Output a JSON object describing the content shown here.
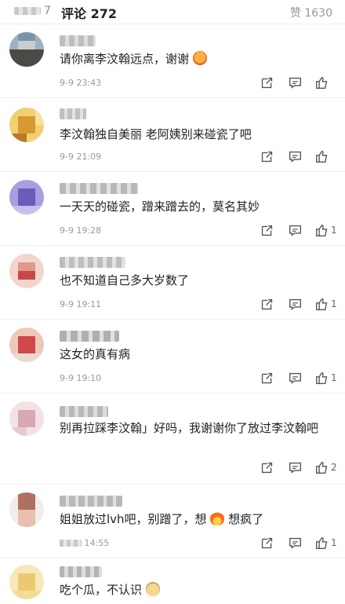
{
  "header": {
    "reposts_suffix": "7",
    "comments_label": "评论 272",
    "likes_label": "赞 1630"
  },
  "comments": [
    {
      "text": "请你离李汶翰远点，谢谢",
      "time": "9-9 23:43",
      "likes": "",
      "emoji": "angry-face-icon",
      "avatar_color": "#6f8aa0"
    },
    {
      "text": "李汶翰独自美丽 老阿姨别来碰瓷了吧",
      "time": "9-9 21:09",
      "likes": "",
      "emoji": "",
      "avatar_color": "#e8c050"
    },
    {
      "text": "一天天的碰瓷，蹭来蹭去的，莫名其妙",
      "time": "9-9 19:28",
      "likes": "1",
      "emoji": "",
      "avatar_color": "#8c7fc8"
    },
    {
      "text": "也不知道自己多大岁数了",
      "time": "9-9 19:11",
      "likes": "1",
      "emoji": "",
      "avatar_color": "#e8b0a8"
    },
    {
      "text": "这女的真有病",
      "time": "9-9 19:10",
      "likes": "1",
      "emoji": "",
      "avatar_color": "#d04848"
    },
    {
      "text": "别再拉踩李汶翰」好吗，我谢谢你了放过李汶翰吧",
      "time": "",
      "likes": "2",
      "emoji": "",
      "avatar_color": "#e4c8d0"
    },
    {
      "text": "姐姐放过lvh吧，别蹭了，想",
      "text2": "想疯了",
      "time": "14:55",
      "likes": "1",
      "emoji": "fire-icon",
      "avatar_color": "#c89078"
    },
    {
      "text": "吃个瓜，不认识",
      "time": "",
      "likes": "",
      "emoji": "doge-icon",
      "avatar_color": "#f0d898"
    }
  ],
  "colors": {
    "accent": "#e86c2c",
    "icon": "#555555"
  }
}
